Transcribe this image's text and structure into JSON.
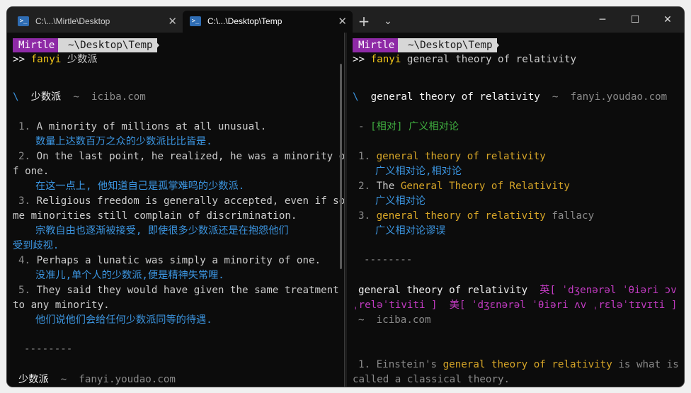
{
  "tabs": [
    {
      "title": "C:\\...\\Mirtle\\Desktop",
      "icon": "powershell-icon"
    },
    {
      "title": "C:\\...\\Desktop\\Temp",
      "icon": "powershell-icon"
    }
  ],
  "tab_controls": {
    "new_tab": "+",
    "dropdown": "⌄"
  },
  "window_controls": {
    "minimize": "─",
    "maximize": "☐",
    "close": "✕"
  },
  "prompt": {
    "user": "Mirtle",
    "path": "~\\Desktop\\Temp",
    "marker": ">>"
  },
  "left": {
    "command": "fanyi",
    "argument": "少数派",
    "source_header": {
      "slash": "\\",
      "term": "少数派",
      "sep": "~",
      "source": "iciba.com"
    },
    "examples": [
      {
        "num": "1.",
        "lines": [
          "A minority of millions at all unusual."
        ],
        "trans": [
          "数量上达数百万之众的少数派比比皆是."
        ]
      },
      {
        "num": "2.",
        "lines": [
          "On the last point, he realized, he was a minority o",
          "f one."
        ],
        "trans": [
          "在这一点上, 他知道自己是孤掌难鸣的少数派."
        ]
      },
      {
        "num": "3.",
        "lines": [
          "Religious freedom is generally accepted, even if so",
          "me minorities still complain of discrimination."
        ],
        "trans": [
          "宗教自由也逐渐被接受, 即使很多少数派还是在抱怨他们",
          "受到歧视."
        ]
      },
      {
        "num": "4.",
        "lines": [
          "Perhaps a lunatic was simply a minority of one."
        ],
        "trans": [
          "没准儿,单个人的少数派,便是精神失常哩."
        ]
      },
      {
        "num": "5.",
        "lines": [
          "They said they would have given the same treatment",
          "to any minority."
        ],
        "trans": [
          "他们说他们会给任何少数派同等的待遇."
        ]
      }
    ],
    "separator": "--------",
    "footer": {
      "term": "少数派",
      "sep": "~",
      "source": "fanyi.youdao.com"
    }
  },
  "right": {
    "command": "fanyi",
    "argument": "general theory of relativity",
    "source_header": {
      "slash": "\\",
      "term": "general theory of relativity",
      "sep": "~",
      "source": "fanyi.youdao.com"
    },
    "definition": {
      "dash": "-",
      "tag": "[相对]",
      "meaning": "广义相对论"
    },
    "results": [
      {
        "num": "1.",
        "pre": "",
        "hl": "general theory of relativity",
        "post": "",
        "trans": "广义相对论,相对论"
      },
      {
        "num": "2.",
        "pre": "The ",
        "hl": "General Theory of Relativity",
        "post": "",
        "trans": "广义相对论"
      },
      {
        "num": "3.",
        "pre": "",
        "hl": "general theory of relativity",
        "post": " fallacy",
        "trans": "广义相对论谬误"
      }
    ],
    "separator": "--------",
    "phonetic": {
      "term": "general theory of relativity",
      "uk_line1": "英[ ˈdʒenərəl ˈθiəri ɔv",
      "uk_line2": "ˌreləˈtiviti ]",
      "us": "美[ ˈdʒɛnərəl ˈθiəri ʌv ˌrɛləˈtɪvɪti ]"
    },
    "iciba_footer": {
      "sep": "~",
      "source": "iciba.com"
    },
    "sentence": {
      "num": "1.",
      "pre": "Einstein's ",
      "hl": "general theory of relativity",
      "post": " is what is",
      "line2": "called a classical theory."
    }
  }
}
